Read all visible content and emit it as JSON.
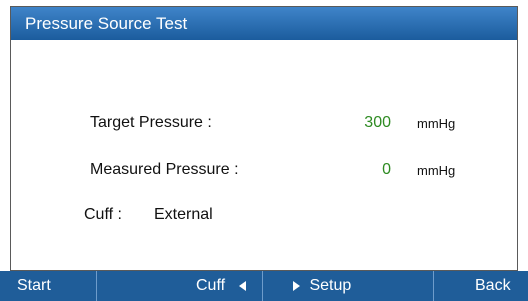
{
  "window": {
    "title": "Pressure Source Test"
  },
  "fields": {
    "target_label": "Target Pressure :",
    "target_value": "300",
    "target_unit": "mmHg",
    "measured_label": "Measured Pressure :",
    "measured_value": "0",
    "measured_unit": "mmHg",
    "cuff_label": "Cuff :",
    "cuff_value": "External"
  },
  "softkeys": {
    "start": "Start",
    "cuff": "Cuff",
    "setup": "Setup",
    "back": "Back"
  },
  "colors": {
    "title_bar": "#1b5c9d",
    "bottom_bar": "#1f5d99",
    "value_accent": "#2e8b22"
  }
}
